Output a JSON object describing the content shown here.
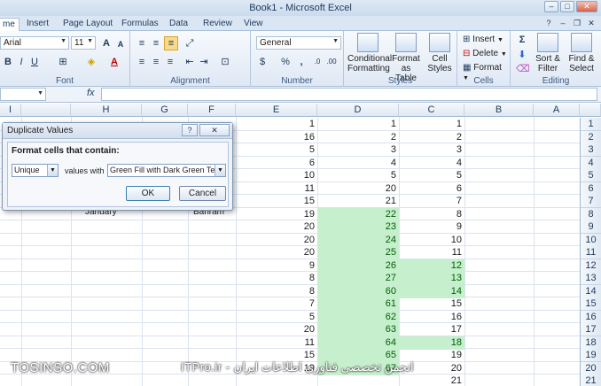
{
  "window": {
    "title": "Book1 - Microsoft Excel",
    "min": "‒",
    "restore": "□",
    "close": "✕"
  },
  "tabs": [
    "me",
    "Insert",
    "Page Layout",
    "Formulas",
    "Data",
    "Review",
    "View"
  ],
  "ribbon": {
    "font": {
      "name": "Arial",
      "size": "11",
      "label": "Font"
    },
    "alignment_label": "Alignment",
    "number": {
      "format": "General",
      "label": "Number",
      "percent": "%",
      "comma": ","
    },
    "styles": {
      "conditional": "Conditional\nFormatting",
      "format_table": "Format\nas Table",
      "cell_styles": "Cell\nStyles",
      "label": "Styles"
    },
    "cells": {
      "insert": "Insert",
      "delete": "Delete",
      "format": "Format",
      "label": "Cells"
    },
    "editing": {
      "sort": "Sort &\nFilter",
      "find": "Find &\nSelect",
      "label": "Editing",
      "sigma": "Σ"
    }
  },
  "formula_bar": {
    "fx": "fx"
  },
  "columns": [
    "A",
    "B",
    "C",
    "D",
    "E",
    "F",
    "G",
    "H",
    "I"
  ],
  "rows": [
    "1",
    "2",
    "3",
    "4",
    "5",
    "6",
    "7",
    "8",
    "9",
    "10",
    "11",
    "12",
    "13",
    "14",
    "15",
    "16",
    "17",
    "18",
    "19",
    "20",
    "21",
    "22"
  ],
  "cells": {
    "E": [
      "1",
      "16",
      "5",
      "6",
      "10",
      "11",
      "15",
      "19",
      "20",
      "20",
      "20",
      "9",
      "8",
      "8",
      "7",
      "5",
      "20",
      "11",
      "15",
      "19"
    ],
    "D": [
      "1",
      "2",
      "3",
      "4",
      "5",
      "20",
      "21",
      "22",
      "23",
      "24",
      "25",
      "26",
      "27",
      "60",
      "61",
      "62",
      "63",
      "64",
      "65",
      "67"
    ],
    "C": [
      "1",
      "2",
      "3",
      "4",
      "5",
      "6",
      "7",
      "8",
      "9",
      "10",
      "11",
      "12",
      "13",
      "14",
      "15",
      "16",
      "17",
      "18",
      "19",
      "20",
      "21"
    ]
  },
  "partial_text": {
    "h9": "January",
    "f9": "Bahram"
  },
  "dialog": {
    "title": "Duplicate Values",
    "help": "?",
    "close": "✕",
    "prompt": "Format cells that contain:",
    "type_value": "Unique",
    "values_with": "values with",
    "format_value": "Green Fill with Dark Green Text",
    "ok": "OK",
    "cancel": "Cancel"
  },
  "watermark": {
    "left": "TOSINSO.COM",
    "right": "ITPro.ir - انجمن تخصصی فناوری اطلاعات ایران"
  },
  "colors": {
    "highlight_fill": "#c6efce",
    "highlight_text": "#006100"
  }
}
